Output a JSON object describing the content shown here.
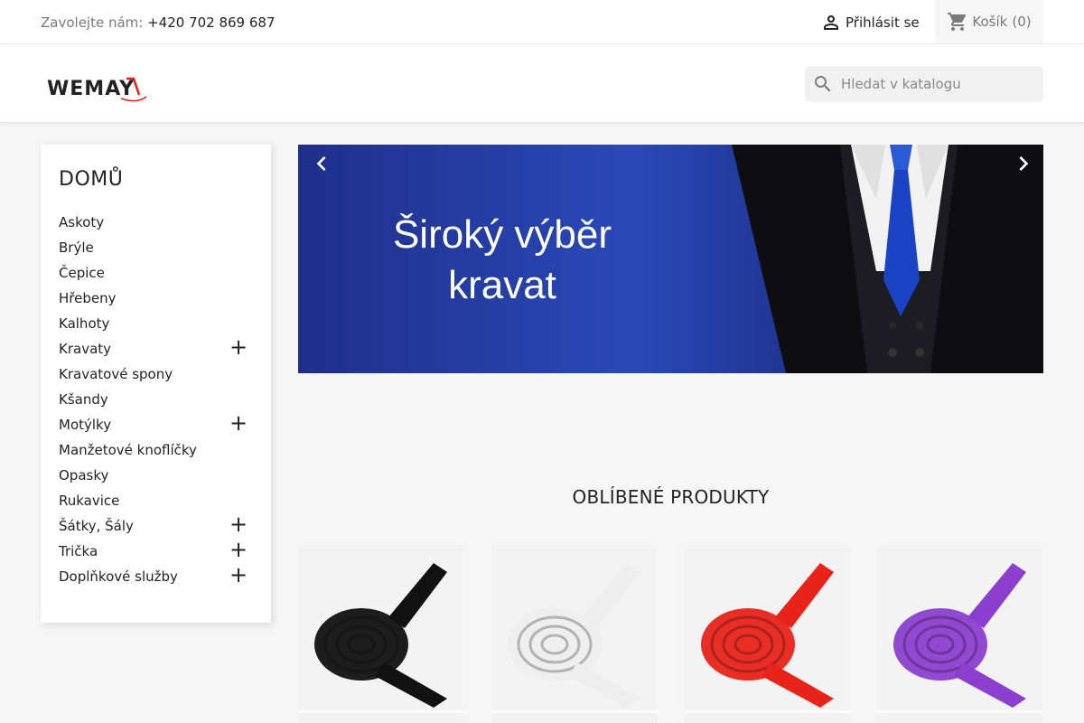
{
  "topbar": {
    "contact_label": "Zavolejte nám:",
    "phone": "+420 702 869 687",
    "login_label": "Přihlásit se",
    "cart_label": "Košík",
    "cart_count": "(0)"
  },
  "header": {
    "logo_text": "WEMAY",
    "search_placeholder": "Hledat v katalogu"
  },
  "sidebar": {
    "title": "DOMŮ",
    "items": [
      {
        "label": "Askoty",
        "expandable": false
      },
      {
        "label": "Brýle",
        "expandable": false
      },
      {
        "label": "Čepice",
        "expandable": false
      },
      {
        "label": "Hřebeny",
        "expandable": false
      },
      {
        "label": "Kalhoty",
        "expandable": false
      },
      {
        "label": "Kravaty",
        "expandable": true
      },
      {
        "label": "Kravatové spony",
        "expandable": false
      },
      {
        "label": "Kšandy",
        "expandable": false
      },
      {
        "label": "Motýlky",
        "expandable": true
      },
      {
        "label": "Manžetové knoflíčky",
        "expandable": false
      },
      {
        "label": "Opasky",
        "expandable": false
      },
      {
        "label": "Rukavice",
        "expandable": false
      },
      {
        "label": "Šátky, Šály",
        "expandable": true
      },
      {
        "label": "Trička",
        "expandable": true
      },
      {
        "label": "Doplňkové služby",
        "expandable": true
      }
    ],
    "expand_symbol": "+"
  },
  "banner": {
    "line1": "Široký výběr",
    "line2": "kravat"
  },
  "featured": {
    "title": "OBLÍBENÉ PRODUKTY",
    "products": [
      {
        "color": "#111111"
      },
      {
        "color": "#eeeeee"
      },
      {
        "color": "#e8231a"
      },
      {
        "color": "#8c3fcf"
      }
    ]
  },
  "colors": {
    "accent": "#232323",
    "banner_blue": "#2a49b8"
  }
}
